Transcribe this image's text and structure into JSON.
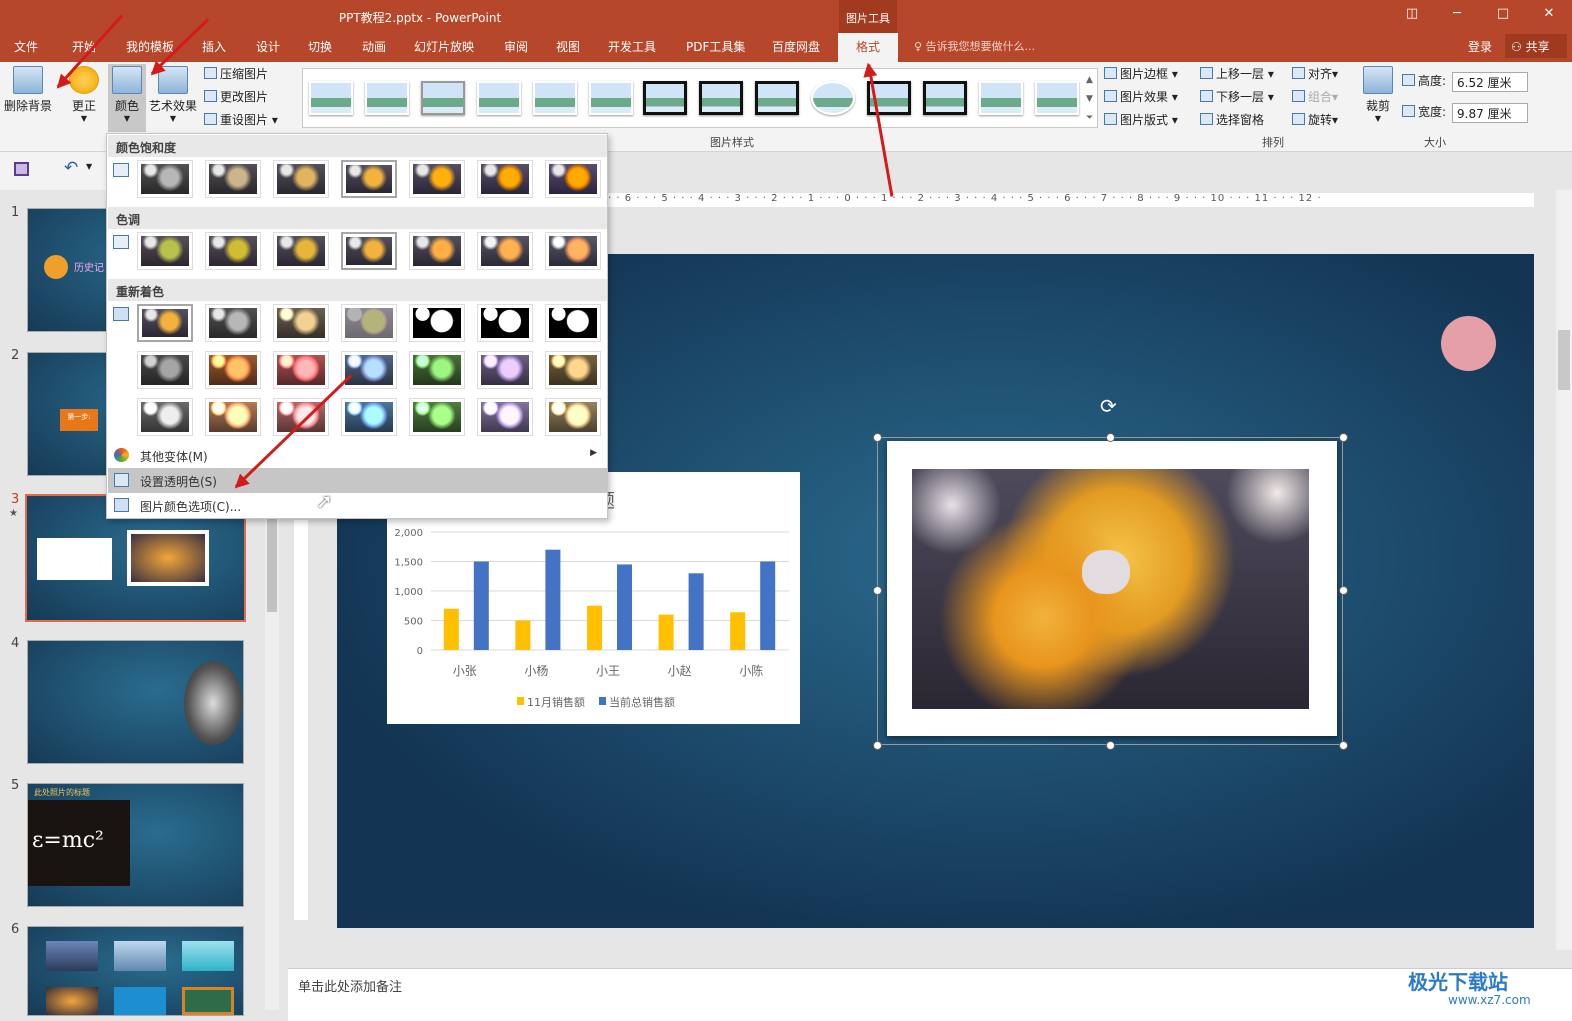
{
  "window": {
    "title": "PPT教程2.pptx - PowerPoint",
    "context_tab_group": "图片工具",
    "controls": {
      "ribbon_display": "◫",
      "minimize": "─",
      "maximize": "□",
      "close": "✕"
    }
  },
  "tabs": [
    "文件",
    "开始",
    "我的模板",
    "插入",
    "设计",
    "切换",
    "动画",
    "幻灯片放映",
    "审阅",
    "视图",
    "开发工具",
    "PDF工具集",
    "百度网盘"
  ],
  "active_tab": "格式",
  "tell_me": "告诉我您想要做什么...",
  "account": {
    "login": "登录",
    "share": "共享"
  },
  "ribbon": {
    "remove_bg": "删除背景",
    "corrections": "更正",
    "color": "颜色",
    "artistic": "艺术效果",
    "compress": "压缩图片",
    "change": "更改图片",
    "reset": "重设图片",
    "styles_group": "图片样式",
    "border": "图片边框",
    "effects": "图片效果",
    "layout": "图片版式",
    "bring_forward": "上移一层",
    "send_backward": "下移一层",
    "selection_pane": "选择窗格",
    "align": "对齐",
    "group": "组合",
    "rotate": "旋转",
    "arrange_group": "排列",
    "crop": "裁剪",
    "height_label": "高度:",
    "height_value": "6.52 厘米",
    "width_label": "宽度:",
    "width_value": "9.87 厘米",
    "size_group": "大小"
  },
  "color_menu": {
    "saturation_title": "颜色饱和度",
    "tone_title": "色调",
    "recolor_title": "重新着色",
    "more_variations": "其他变体(M)",
    "set_transparent": "设置透明色(S)",
    "color_options": "图片颜色选项(C)..."
  },
  "ruler_h": "· · 6 · · · 5 · · · 4 · · · 3 · · · 2 · · · 1 · · · 0 · · · 1 · · · 2 · · · 3 · · · 4 · · · 5 · · · 6 · · · 7 · · · 8 · · · 9 · · · 10 · · · 11 · · · 12 ·",
  "slides": [
    {
      "num": "1",
      "text": "历史记"
    },
    {
      "num": "2",
      "text": "第一步:"
    },
    {
      "num": "3",
      "text": ""
    },
    {
      "num": "4",
      "text": ""
    },
    {
      "num": "5",
      "text": "此处照片的标题"
    },
    {
      "num": "6",
      "text": ""
    }
  ],
  "notes_placeholder": "单击此处添加备注",
  "slide_chart_title_fragment": "标题",
  "chart_data": {
    "type": "bar",
    "title": "标题",
    "categories": [
      "小张",
      "小杨",
      "小王",
      "小赵",
      "小陈"
    ],
    "series": [
      {
        "name": "11月销售额",
        "color": "#ffc000",
        "values": [
          700,
          500,
          750,
          600,
          640
        ]
      },
      {
        "name": "当前总销售额",
        "color": "#4472c4",
        "values": [
          1500,
          1700,
          1450,
          1300,
          1500
        ]
      }
    ],
    "ylim": [
      0,
      2000
    ],
    "yticks": [
      "0",
      "500",
      "1,000",
      "1,500",
      "2,000"
    ],
    "grid": true,
    "legend": "bottom"
  },
  "watermark": {
    "text": "极光下载站",
    "url": "www.xz7.com"
  }
}
